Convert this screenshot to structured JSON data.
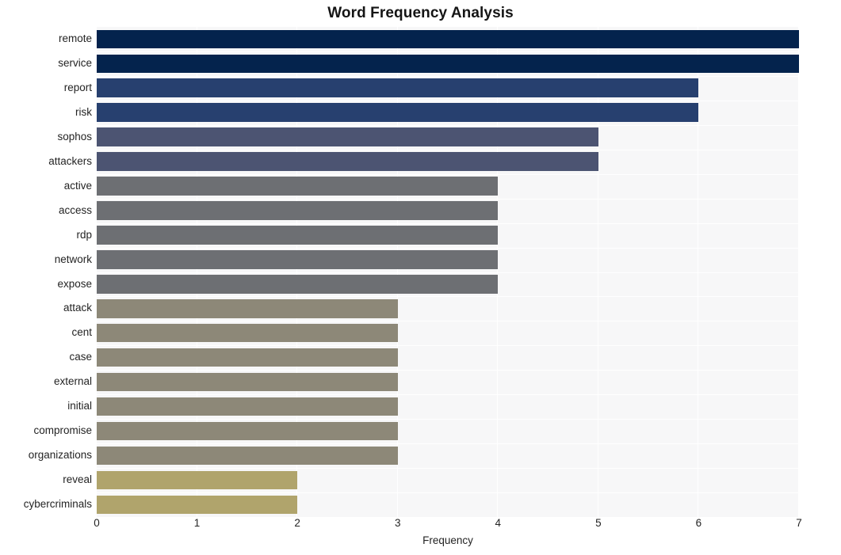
{
  "chart_data": {
    "type": "bar",
    "orientation": "horizontal",
    "title": "Word Frequency Analysis",
    "xlabel": "Frequency",
    "ylabel": "",
    "xlim": [
      0,
      7
    ],
    "ylim": null,
    "grid": true,
    "grid_axis": "x",
    "legend": false,
    "legend_position": "none",
    "plot_background": "#f7f7f8",
    "figure_background": "#ffffff",
    "xticks": [
      0,
      1,
      2,
      3,
      4,
      5,
      6,
      7
    ],
    "xtick_labels": [
      "0",
      "1",
      "2",
      "3",
      "4",
      "5",
      "6",
      "7"
    ],
    "categories": [
      "remote",
      "service",
      "report",
      "risk",
      "sophos",
      "attackers",
      "active",
      "access",
      "rdp",
      "network",
      "expose",
      "attack",
      "cent",
      "case",
      "external",
      "initial",
      "compromise",
      "organizations",
      "reveal",
      "cybercriminals"
    ],
    "values": [
      7,
      7,
      6,
      6,
      5,
      5,
      4,
      4,
      4,
      4,
      4,
      3,
      3,
      3,
      3,
      3,
      3,
      3,
      2,
      2
    ],
    "colors": [
      "#04234d",
      "#04234d",
      "#27406f",
      "#27406f",
      "#4c5472",
      "#4c5472",
      "#6d6f73",
      "#6d6f73",
      "#6d6f73",
      "#6d6f73",
      "#6d6f73",
      "#8d8878",
      "#8d8878",
      "#8d8878",
      "#8d8878",
      "#8d8878",
      "#8d8878",
      "#8d8878",
      "#b0a46c",
      "#b0a46c"
    ],
    "bars": [
      {
        "label": "remote",
        "value": 7,
        "color": "#04234d"
      },
      {
        "label": "service",
        "value": 7,
        "color": "#04234d"
      },
      {
        "label": "report",
        "value": 6,
        "color": "#27406f"
      },
      {
        "label": "risk",
        "value": 6,
        "color": "#27406f"
      },
      {
        "label": "sophos",
        "value": 5,
        "color": "#4c5472"
      },
      {
        "label": "attackers",
        "value": 5,
        "color": "#4c5472"
      },
      {
        "label": "active",
        "value": 4,
        "color": "#6d6f73"
      },
      {
        "label": "access",
        "value": 4,
        "color": "#6d6f73"
      },
      {
        "label": "rdp",
        "value": 4,
        "color": "#6d6f73"
      },
      {
        "label": "network",
        "value": 4,
        "color": "#6d6f73"
      },
      {
        "label": "expose",
        "value": 4,
        "color": "#6d6f73"
      },
      {
        "label": "attack",
        "value": 3,
        "color": "#8d8878"
      },
      {
        "label": "cent",
        "value": 3,
        "color": "#8d8878"
      },
      {
        "label": "case",
        "value": 3,
        "color": "#8d8878"
      },
      {
        "label": "external",
        "value": 3,
        "color": "#8d8878"
      },
      {
        "label": "initial",
        "value": 3,
        "color": "#8d8878"
      },
      {
        "label": "compromise",
        "value": 3,
        "color": "#8d8878"
      },
      {
        "label": "organizations",
        "value": 3,
        "color": "#8d8878"
      },
      {
        "label": "reveal",
        "value": 2,
        "color": "#b0a46c"
      },
      {
        "label": "cybercriminals",
        "value": 2,
        "color": "#b0a46c"
      }
    ]
  }
}
